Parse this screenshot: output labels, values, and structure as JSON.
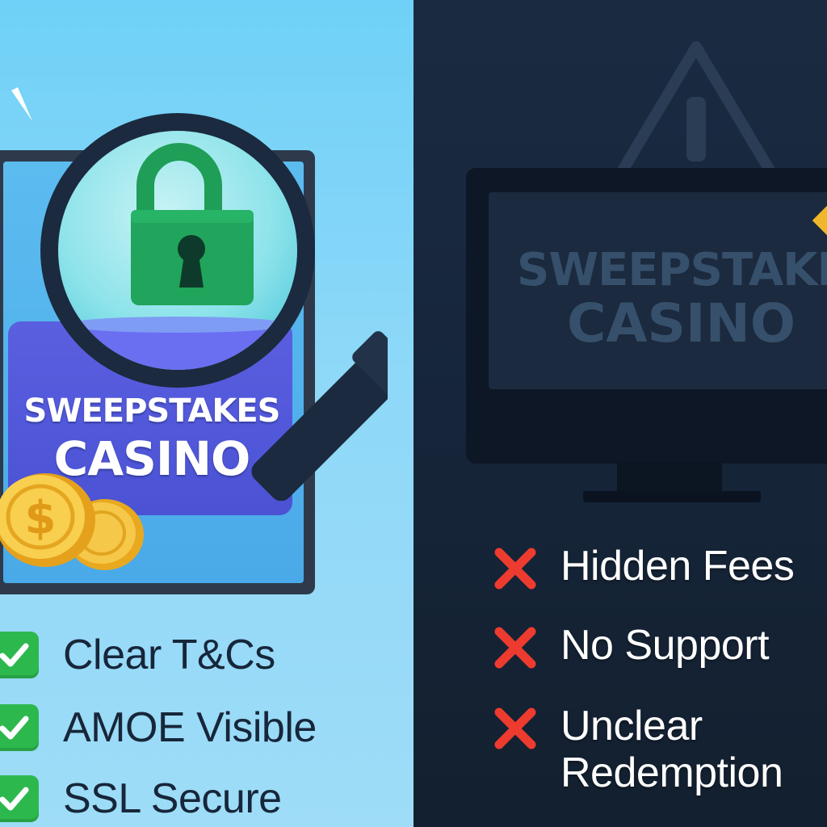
{
  "left_panel": {
    "background_color": "#7fd6f8",
    "casino_title": {
      "line1": "SWEEPSTAKES",
      "line2": "CASINO"
    },
    "checklist": [
      {
        "label": "Clear T&Cs",
        "icon": "checkmark-icon"
      },
      {
        "label": "AMOE Visible",
        "icon": "checkmark-icon"
      },
      {
        "label": "SSL Secure",
        "icon": "checkmark-icon"
      }
    ],
    "colors": {
      "check": "#2db84e",
      "lock": "#1f9e57",
      "banner": "#4f56d8"
    }
  },
  "right_panel": {
    "background_color": "#172638",
    "casino_title": {
      "line1": "SWEEPSTAKES",
      "line2": "CASINO"
    },
    "problems": [
      {
        "line1": "Hidden Fees",
        "line2": "",
        "icon": "x-mark-icon"
      },
      {
        "line1": "No Support",
        "line2": "",
        "icon": "x-mark-icon"
      },
      {
        "line1": "Unclear",
        "line2": "Redemption",
        "icon": "x-mark-icon"
      }
    ],
    "colors": {
      "x_mark": "#ee3b2f"
    }
  }
}
